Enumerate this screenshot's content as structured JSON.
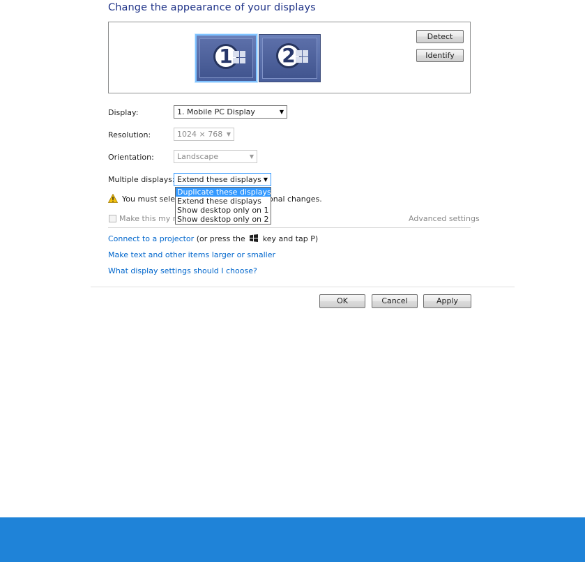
{
  "heading": "Change the appearance of your displays",
  "preview": {
    "monitors": [
      {
        "number": "1",
        "selected": true
      },
      {
        "number": "2",
        "selected": false
      }
    ],
    "detect_label": "Detect",
    "identify_label": "Identify"
  },
  "display": {
    "label": "Display:",
    "value": "1. Mobile PC Display"
  },
  "resolution": {
    "label": "Resolution:",
    "value": "1024 × 768",
    "disabled": true
  },
  "orientation": {
    "label": "Orientation:",
    "value": "Landscape",
    "disabled": true
  },
  "multiple": {
    "label": "Multiple displays:",
    "value": "Extend these displays",
    "options": [
      "Duplicate these displays",
      "Extend these displays",
      "Show desktop only on 1",
      "Show desktop only on 2"
    ],
    "highlighted_index": 0
  },
  "warning": {
    "text_before": "You must selec",
    "text_after": "onal changes."
  },
  "make_primary": {
    "label": "Make this my ma"
  },
  "advanced_settings": "Advanced settings",
  "links": {
    "projector_link": "Connect to a projector",
    "projector_suffix_1": "(or press the",
    "projector_suffix_2": "key and tap P)",
    "text_size": "Make text and other items larger or smaller",
    "which_settings": "What display settings should I choose?"
  },
  "buttons": {
    "ok": "OK",
    "cancel": "Cancel",
    "apply": "Apply"
  },
  "colors": {
    "link": "#0066cc",
    "heading": "#1e3287",
    "highlight": "#3399ff",
    "footer_band": "#1f83d8"
  }
}
